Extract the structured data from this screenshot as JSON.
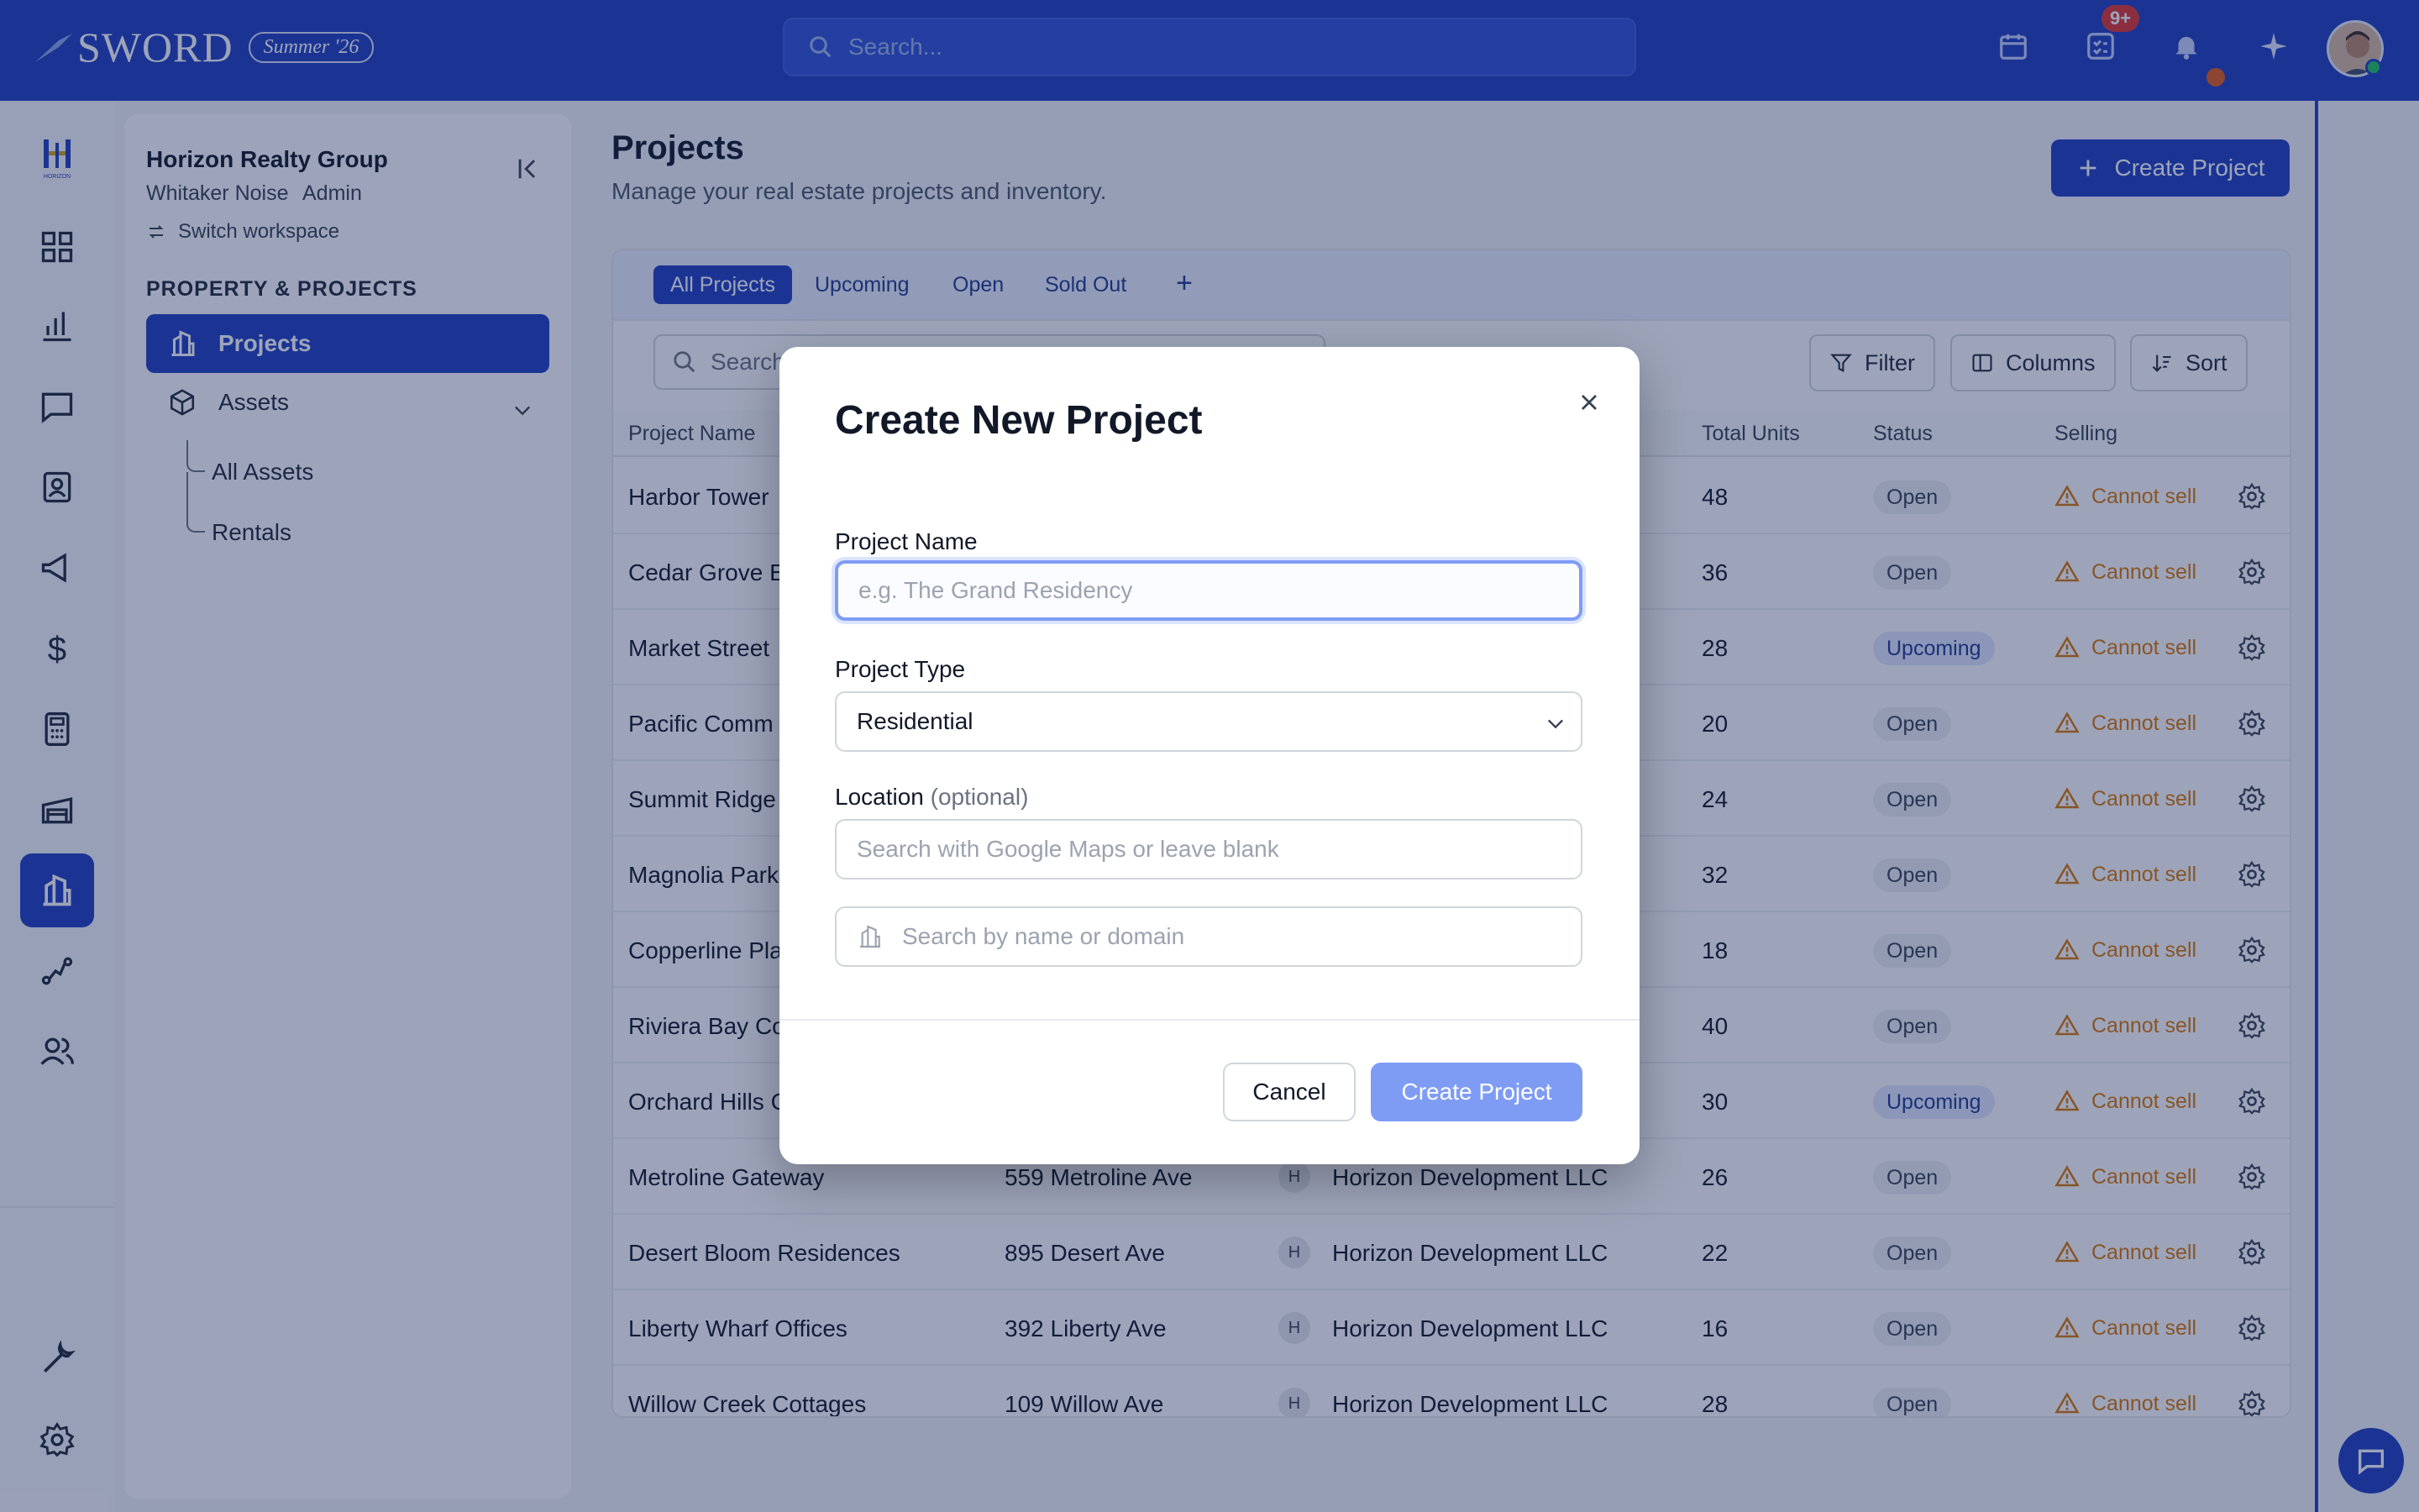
{
  "topbar": {
    "brand": "SWORD",
    "season": "Summer '26",
    "search_placeholder": "Search...",
    "notification_badge": "9+",
    "icons": [
      "calendar-icon",
      "checklist-icon",
      "bell-icon",
      "sparkle-icon"
    ]
  },
  "rail": {
    "logo_text": "HORIZON",
    "icons": [
      "dashboard-icon",
      "analytics-icon",
      "messages-icon",
      "contacts-icon",
      "campaigns-icon",
      "finance-icon",
      "calculator-icon",
      "warehouse-icon",
      "projects-icon",
      "workflow-icon",
      "team-icon",
      "tools-icon",
      "settings-icon"
    ],
    "active": "projects-icon"
  },
  "sidebar": {
    "workspace_name": "Horizon Realty Group",
    "user_name": "Whitaker Noise",
    "user_role": "Admin",
    "switch_label": "Switch workspace",
    "section_heading": "PROPERTY & PROJECTS",
    "active_item": "Projects",
    "items": [
      {
        "label": "Assets",
        "children": [
          "All Assets",
          "Rentals"
        ]
      }
    ]
  },
  "page": {
    "title": "Projects",
    "subtitle": "Manage your real estate projects and inventory.",
    "create_button": "Create Project"
  },
  "tabs": [
    "All Projects",
    "Upcoming",
    "Open",
    "Sold Out"
  ],
  "toolbar": {
    "search_placeholder": "Search",
    "filter": "Filter",
    "columns": "Columns",
    "sort": "Sort"
  },
  "table": {
    "headers": {
      "name": "Project Name",
      "units": "Total Units",
      "status": "Status",
      "selling": "Selling"
    },
    "rows": [
      {
        "name": "Harbor Tower",
        "address": "",
        "dev_initial": "",
        "developer": "",
        "units": "48",
        "status": "Open",
        "selling": "Cannot sell"
      },
      {
        "name": "Cedar Grove E",
        "address": "",
        "dev_initial": "",
        "developer": "",
        "units": "36",
        "status": "Open",
        "selling": "Cannot sell"
      },
      {
        "name": "Market Street",
        "address": "",
        "dev_initial": "",
        "developer": "",
        "units": "28",
        "status": "Upcoming",
        "selling": "Cannot sell"
      },
      {
        "name": "Pacific Comm",
        "address": "",
        "dev_initial": "",
        "developer": "",
        "units": "20",
        "status": "Open",
        "selling": "Cannot sell"
      },
      {
        "name": "Summit Ridge",
        "address": "",
        "dev_initial": "",
        "developer": "",
        "units": "24",
        "status": "Open",
        "selling": "Cannot sell"
      },
      {
        "name": "Magnolia Park",
        "address": "",
        "dev_initial": "",
        "developer": "",
        "units": "32",
        "status": "Open",
        "selling": "Cannot sell"
      },
      {
        "name": "Copperline Pla",
        "address": "",
        "dev_initial": "",
        "developer": "",
        "units": "18",
        "status": "Open",
        "selling": "Cannot sell"
      },
      {
        "name": "Riviera Bay Co",
        "address": "",
        "dev_initial": "",
        "developer": "",
        "units": "40",
        "status": "Open",
        "selling": "Cannot sell"
      },
      {
        "name": "Orchard Hills C",
        "address": "",
        "dev_initial": "",
        "developer": "",
        "units": "30",
        "status": "Upcoming",
        "selling": "Cannot sell"
      },
      {
        "name": "Metroline Gateway",
        "address": "559 Metroline Ave",
        "dev_initial": "H",
        "developer": "Horizon Development LLC",
        "units": "26",
        "status": "Open",
        "selling": "Cannot sell"
      },
      {
        "name": "Desert Bloom Residences",
        "address": "895 Desert Ave",
        "dev_initial": "H",
        "developer": "Horizon Development LLC",
        "units": "22",
        "status": "Open",
        "selling": "Cannot sell"
      },
      {
        "name": "Liberty Wharf Offices",
        "address": "392 Liberty Ave",
        "dev_initial": "H",
        "developer": "Horizon Development LLC",
        "units": "16",
        "status": "Open",
        "selling": "Cannot sell"
      },
      {
        "name": "Willow Creek Cottages",
        "address": "109 Willow Ave",
        "dev_initial": "H",
        "developer": "Horizon Development LLC",
        "units": "28",
        "status": "Open",
        "selling": "Cannot sell"
      }
    ]
  },
  "modal": {
    "title": "Create New Project",
    "name_label": "Project Name",
    "name_placeholder": "e.g. The Grand Residency",
    "type_label": "Project Type",
    "type_value": "Residential",
    "location_label": "Location",
    "location_optional": "(optional)",
    "location_placeholder": "Search with Google Maps or leave blank",
    "company_placeholder": "Search by name or domain",
    "cancel": "Cancel",
    "submit": "Create Project"
  },
  "colors": {
    "primary": "#1f3fbf",
    "warning": "#d97706",
    "submit_disabled": "#7f9cf5"
  }
}
